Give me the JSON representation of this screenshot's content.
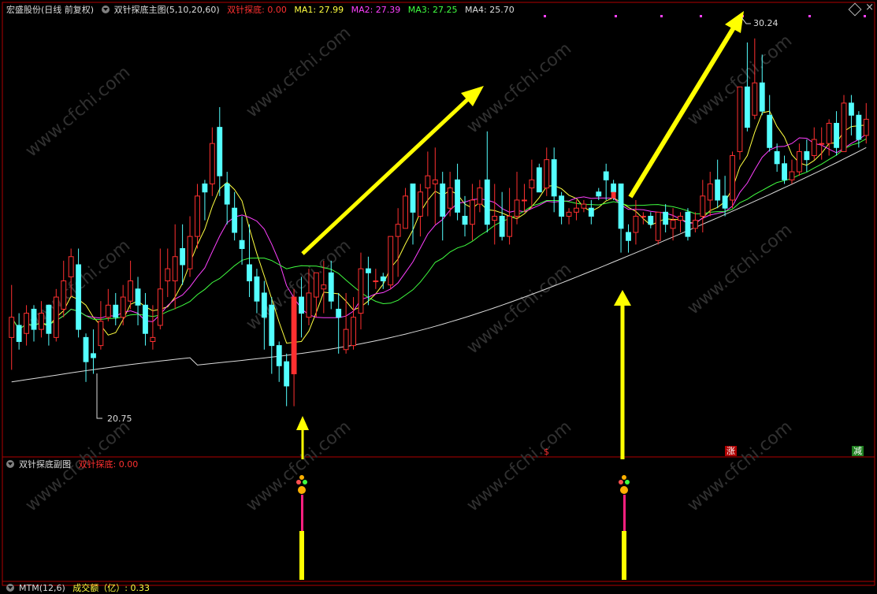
{
  "main_header": {
    "stock": "宏盛股份(日线 前复权)",
    "indicator": "双针探底主图",
    "params": "(5,10,20,60)",
    "signal_label": "双针探底: 0.00",
    "ma1": "MA1: 27.99",
    "ma2": "MA2: 27.39",
    "ma3": "MA3: 27.25",
    "ma4": "MA4: 25.70"
  },
  "price_labels": {
    "high": "30.24",
    "low": "20.75"
  },
  "badges": {
    "s": "$",
    "zhang": "涨",
    "jian": "减"
  },
  "sub_header": {
    "title": "双针探底副图",
    "signal_label": "双针探底: 0.00"
  },
  "bottom_header": {
    "mtm": "MTM(12,6)",
    "volume_label": "成交额（亿）: 0.33"
  },
  "colors": {
    "up": "#ff3030",
    "down": "#54ffff",
    "ma1": "#ffff40",
    "ma2": "#ff40ff",
    "ma3": "#40ff40",
    "ma4": "#dcdcdc",
    "arrow": "#ffff00",
    "border": "#b00000"
  },
  "watermark": "www.cfchi.com",
  "chart_data": {
    "type": "candlestick",
    "ylim": [
      20.0,
      30.8
    ],
    "candles": [
      [
        22.8,
        23.3,
        22.0,
        24.1
      ],
      [
        23.1,
        22.7,
        22.5,
        23.4
      ],
      [
        22.9,
        23.4,
        22.6,
        23.6
      ],
      [
        23.5,
        23.0,
        22.7,
        23.6
      ],
      [
        23.0,
        23.4,
        22.8,
        23.7
      ],
      [
        23.6,
        22.9,
        22.6,
        23.6
      ],
      [
        22.8,
        23.8,
        22.7,
        24.0
      ],
      [
        23.5,
        24.2,
        23.3,
        24.7
      ],
      [
        24.3,
        24.8,
        23.8,
        25.0
      ],
      [
        24.6,
        23.0,
        22.8,
        25.0
      ],
      [
        22.8,
        22.2,
        21.7,
        22.9
      ],
      [
        22.4,
        22.3,
        21.9,
        23.0
      ],
      [
        22.6,
        23.2,
        22.5,
        23.7
      ],
      [
        23.3,
        23.6,
        23.2,
        24.0
      ],
      [
        23.6,
        23.3,
        23.1,
        23.9
      ],
      [
        23.3,
        23.8,
        23.1,
        24.1
      ],
      [
        23.7,
        24.2,
        23.5,
        24.7
      ],
      [
        24.0,
        23.6,
        23.1,
        24.3
      ],
      [
        23.6,
        22.9,
        22.6,
        23.9
      ],
      [
        22.7,
        22.8,
        22.5,
        23.6
      ],
      [
        23.1,
        24.0,
        23.0,
        25.0
      ],
      [
        24.2,
        24.5,
        23.8,
        25.0
      ],
      [
        24.2,
        24.8,
        23.5,
        25.6
      ],
      [
        25.0,
        24.6,
        24.1,
        25.6
      ],
      [
        24.5,
        25.3,
        24.3,
        25.8
      ],
      [
        25.3,
        26.3,
        25.0,
        26.6
      ],
      [
        26.6,
        26.4,
        25.7,
        26.7
      ],
      [
        26.6,
        27.6,
        26.3,
        28.0
      ],
      [
        28.0,
        26.8,
        26.3,
        28.5
      ],
      [
        26.6,
        26.1,
        25.6,
        26.9
      ],
      [
        26.0,
        25.4,
        25.2,
        26.4
      ],
      [
        25.2,
        25.0,
        24.6,
        25.8
      ],
      [
        24.6,
        24.2,
        23.8,
        25.6
      ],
      [
        24.3,
        23.7,
        23.4,
        24.5
      ],
      [
        23.9,
        23.3,
        22.5,
        24.2
      ],
      [
        23.6,
        22.6,
        21.9,
        23.8
      ],
      [
        22.6,
        22.1,
        21.7,
        22.7
      ],
      [
        22.2,
        21.6,
        21.1,
        22.4
      ],
      [
        21.9,
        23.8,
        21.1,
        24.0
      ],
      [
        23.8,
        23.4,
        22.8,
        24.3
      ],
      [
        23.3,
        23.9,
        23.1,
        24.5
      ],
      [
        23.8,
        24.4,
        23.3,
        24.4
      ],
      [
        24.0,
        24.1,
        23.4,
        24.7
      ],
      [
        24.4,
        23.7,
        23.5,
        24.7
      ],
      [
        23.5,
        23.3,
        22.4,
        23.9
      ],
      [
        22.5,
        23.0,
        22.4,
        23.9
      ],
      [
        22.6,
        23.3,
        22.5,
        23.8
      ],
      [
        23.4,
        24.5,
        23.0,
        24.9
      ],
      [
        24.5,
        24.4,
        23.6,
        24.8
      ],
      [
        24.2,
        24.2,
        24.0,
        24.5
      ],
      [
        24.3,
        24.2,
        24.0,
        24.4
      ],
      [
        24.1,
        25.3,
        24.0,
        25.3
      ],
      [
        25.3,
        25.6,
        24.3,
        26.0
      ],
      [
        25.5,
        26.3,
        25.5,
        26.5
      ],
      [
        26.6,
        25.9,
        25.1,
        26.6
      ],
      [
        25.8,
        26.4,
        25.3,
        26.6
      ],
      [
        26.5,
        26.8,
        25.8,
        27.4
      ],
      [
        26.6,
        26.7,
        25.6,
        27.5
      ],
      [
        26.6,
        25.8,
        25.2,
        26.9
      ],
      [
        26.0,
        26.5,
        25.8,
        26.9
      ],
      [
        26.7,
        25.9,
        25.7,
        27.1
      ],
      [
        25.8,
        25.6,
        25.3,
        26.3
      ],
      [
        25.6,
        26.2,
        25.2,
        26.6
      ],
      [
        26.1,
        26.5,
        25.9,
        26.7
      ],
      [
        26.7,
        25.6,
        25.4,
        27.9
      ],
      [
        25.7,
        25.8,
        25.1,
        26.6
      ],
      [
        25.8,
        25.3,
        25.2,
        26.4
      ],
      [
        25.3,
        25.8,
        25.1,
        26.5
      ],
      [
        25.8,
        26.2,
        25.6,
        26.9
      ],
      [
        26.2,
        26.2,
        25.9,
        26.6
      ],
      [
        26.5,
        26.7,
        26.0,
        27.2
      ],
      [
        27.0,
        26.4,
        26.4,
        27.1
      ],
      [
        26.5,
        27.2,
        26.3,
        27.5
      ],
      [
        27.2,
        26.3,
        25.9,
        27.5
      ],
      [
        26.3,
        25.8,
        25.6,
        26.4
      ],
      [
        25.8,
        25.9,
        25.6,
        26.0
      ],
      [
        25.9,
        26.0,
        25.7,
        26.2
      ],
      [
        26.0,
        26.1,
        25.9,
        26.2
      ],
      [
        26.0,
        25.8,
        25.6,
        26.2
      ],
      [
        26.4,
        26.3,
        26.2,
        26.5
      ],
      [
        26.9,
        26.7,
        26.2,
        27.1
      ],
      [
        26.6,
        26.4,
        26.2,
        26.7
      ],
      [
        26.6,
        25.5,
        24.9,
        26.6
      ],
      [
        25.4,
        25.2,
        24.9,
        25.6
      ],
      [
        25.4,
        25.8,
        25.1,
        26.2
      ],
      [
        25.8,
        25.8,
        25.6,
        25.9
      ],
      [
        25.8,
        25.6,
        25.5,
        25.9
      ],
      [
        25.2,
        25.9,
        25.1,
        25.9
      ],
      [
        25.9,
        25.6,
        25.4,
        26.1
      ],
      [
        25.5,
        25.7,
        25.2,
        26.0
      ],
      [
        25.7,
        25.8,
        25.4,
        25.9
      ],
      [
        25.9,
        25.3,
        25.2,
        26.0
      ],
      [
        25.5,
        25.7,
        25.4,
        25.9
      ],
      [
        25.8,
        26.3,
        25.4,
        26.7
      ],
      [
        26.2,
        26.6,
        25.8,
        26.9
      ],
      [
        26.7,
        26.2,
        26.0,
        27.2
      ],
      [
        26.3,
        26.0,
        25.8,
        26.8
      ],
      [
        26.2,
        27.3,
        26.0,
        27.4
      ],
      [
        27.4,
        29.0,
        27.2,
        29.0
      ],
      [
        29.0,
        28.0,
        27.9,
        30.1
      ],
      [
        28.3,
        29.1,
        28.2,
        30.2
      ],
      [
        29.1,
        28.4,
        28.3,
        29.8
      ],
      [
        28.3,
        27.5,
        27.4,
        28.8
      ],
      [
        27.4,
        27.1,
        26.9,
        27.6
      ],
      [
        27.1,
        26.7,
        26.6,
        27.3
      ],
      [
        26.7,
        26.9,
        26.6,
        27.2
      ],
      [
        26.9,
        27.4,
        26.8,
        27.6
      ],
      [
        27.4,
        27.2,
        26.9,
        27.7
      ],
      [
        27.3,
        27.7,
        27.2,
        28.0
      ],
      [
        27.6,
        27.6,
        27.2,
        28.0
      ],
      [
        27.6,
        28.1,
        27.3,
        28.2
      ],
      [
        28.1,
        27.5,
        27.3,
        28.4
      ],
      [
        27.4,
        28.6,
        27.4,
        28.8
      ],
      [
        28.6,
        28.3,
        27.8,
        28.8
      ],
      [
        28.3,
        27.7,
        27.5,
        28.4
      ],
      [
        27.8,
        28.2,
        27.6,
        28.6
      ]
    ],
    "ma4_range": [
      21.5,
      27.5
    ]
  }
}
